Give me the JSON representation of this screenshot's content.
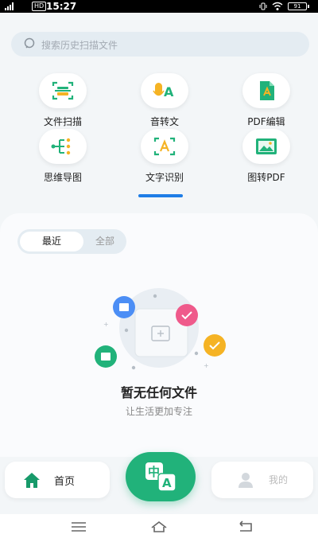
{
  "status_bar": {
    "time": "15:27",
    "hd_label": "HD",
    "battery": "91"
  },
  "search": {
    "placeholder": "搜索历史扫描文件",
    "icon": "search-icon"
  },
  "tools": [
    {
      "label": "文件扫描",
      "icon": "scan-icon"
    },
    {
      "label": "音转文",
      "icon": "audio-to-text-icon"
    },
    {
      "label": "PDF编辑",
      "icon": "pdf-edit-icon"
    },
    {
      "label": "思维导图",
      "icon": "mind-map-icon"
    },
    {
      "label": "文字识别",
      "icon": "ocr-icon"
    },
    {
      "label": "图转PDF",
      "icon": "image-to-pdf-icon"
    }
  ],
  "tabs": {
    "recent": "最近",
    "all": "全部"
  },
  "empty_state": {
    "title": "暂无任何文件",
    "subtitle": "让生活更加专注"
  },
  "bottom_nav": {
    "home_label": "首页",
    "mine_label": "我的",
    "center_glyph_top": "中",
    "center_glyph_bottom": "A"
  },
  "colors": {
    "accent": "#21b27a",
    "indicator": "#1e7de6",
    "background": "#f3f6f8"
  }
}
